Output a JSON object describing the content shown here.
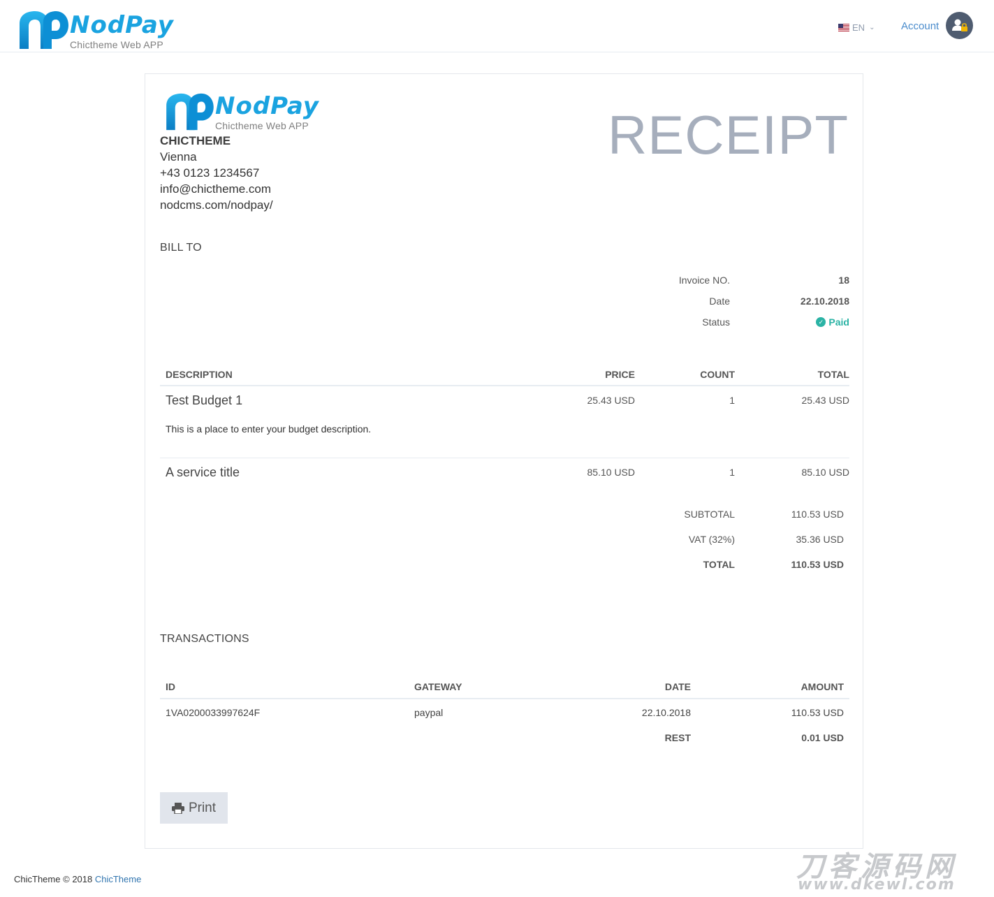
{
  "header": {
    "brand_name": "NodPay",
    "brand_sub": "Chictheme Web APP",
    "lang": "EN",
    "account_label": "Account"
  },
  "card": {
    "brand_name": "NodPay",
    "brand_sub": "Chictheme Web APP",
    "company": {
      "name": "CHICTHEME",
      "city": "Vienna",
      "phone": "+43 0123 1234567",
      "email": "info@chictheme.com",
      "website": "nodcms.com/nodpay/"
    },
    "title": "RECEIPT",
    "bill_to_label": "BILL TO",
    "meta": {
      "invoice_label": "Invoice NO.",
      "invoice_value": "18",
      "date_label": "Date",
      "date_value": "22.10.2018",
      "status_label": "Status",
      "status_value": "Paid"
    },
    "items_table": {
      "headers": {
        "description": "DESCRIPTION",
        "price": "PRICE",
        "count": "COUNT",
        "total": "TOTAL"
      },
      "rows": [
        {
          "title": "Test Budget 1",
          "price": "25.43 USD",
          "count": "1",
          "total": "25.43 USD",
          "description": "This is a place to enter your budget description."
        },
        {
          "title": "A service title",
          "price": "85.10 USD",
          "count": "1",
          "total": "85.10 USD",
          "description": ""
        }
      ]
    },
    "totals": {
      "subtotal_label": "SUBTOTAL",
      "subtotal_value": "110.53 USD",
      "vat_label": "VAT (32%)",
      "vat_value": "35.36 USD",
      "total_label": "TOTAL",
      "total_value": "110.53 USD"
    },
    "transactions_label": "TRANSACTIONS",
    "transactions_table": {
      "headers": {
        "id": "ID",
        "gateway": "GATEWAY",
        "date": "DATE",
        "amount": "AMOUNT"
      },
      "rows": [
        {
          "id": "1VA0200033997624F",
          "gateway": "paypal",
          "date": "22.10.2018",
          "amount": "110.53 USD"
        }
      ],
      "rest_label": "REST",
      "rest_value": "0.01 USD"
    },
    "print_label": "Print"
  },
  "footer": {
    "text": "ChicTheme",
    "year": "2018",
    "link": "ChicTheme"
  },
  "watermark": {
    "cn": "刀客源码网",
    "url": "www.dkewl.com"
  },
  "colors": {
    "brand_blue": "#1aa3e0",
    "status_paid": "#2bb3a5",
    "link": "#4b8ccc",
    "receipt_title": "#a6aebc"
  }
}
